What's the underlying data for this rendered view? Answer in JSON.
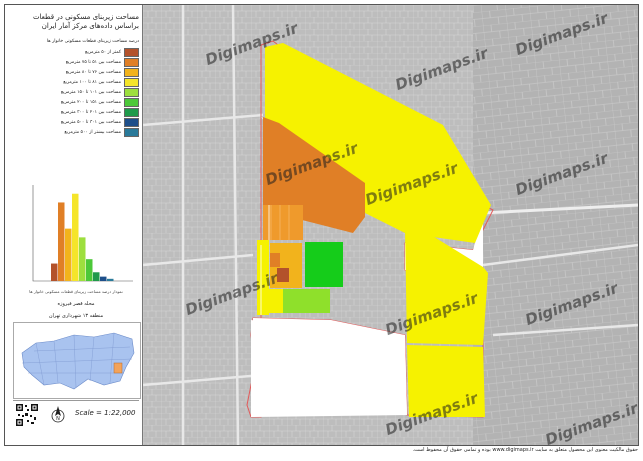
{
  "panel": {
    "title_line1": "مساحت زیربنای مسکونی در قطعات",
    "title_line2": "براساس داده‌های مرکز آمار ایران",
    "legend_heading": "درصد مساحت زیربنای قطعات مسکونی خانوار ها",
    "legend": [
      {
        "label": "کمتر از ۵۰ مترمربع",
        "color": "#b3522b"
      },
      {
        "label": "مساحت بین ۵۱ تا ۷۵ مترمربع",
        "color": "#e07f26"
      },
      {
        "label": "مساحت بین ۷۶ تا ۸۰ مترمربع",
        "color": "#f2b31c"
      },
      {
        "label": "مساحت بین ۸۱ تا ۱۰۰ مترمربع",
        "color": "#f5e52a"
      },
      {
        "label": "مساحت بین ۱۰۱ تا ۱۵۰ مترمربع",
        "color": "#9ddf3e"
      },
      {
        "label": "مساحت بین ۱۵۱ تا ۲۰۰ مترمربع",
        "color": "#4cc839"
      },
      {
        "label": "مساحت بین ۲۰۱ تا ۳۰۰ مترمربع",
        "color": "#1f9a4b"
      },
      {
        "label": "مساحت بین ۳۰۱ تا ۵۰۰ مترمربع",
        "color": "#1e4f8a"
      },
      {
        "label": "مساحت بیشتر از ۵۰۰ مترمربع",
        "color": "#2a7a9a"
      }
    ],
    "histogram_caption": "نمودار درصد مساحت زیربنای قطعات مسکونی خانوار ها",
    "region_name": "محله قصر فیروزه",
    "district": "منطقه ۱۳ شهرداری تهران",
    "scale": "Scale = 1:22,000"
  },
  "histogram": {
    "values": [
      4,
      18,
      12,
      20,
      10,
      5,
      2,
      1,
      0.5
    ],
    "ylim": [
      0,
      22
    ]
  },
  "watermark": "Digimaps.ir",
  "footer": "حقوق مالکیت معنوی این محصول متعلق به سایت www.digimaps.ir بوده و تمامی حقوق آن محفوظ است."
}
